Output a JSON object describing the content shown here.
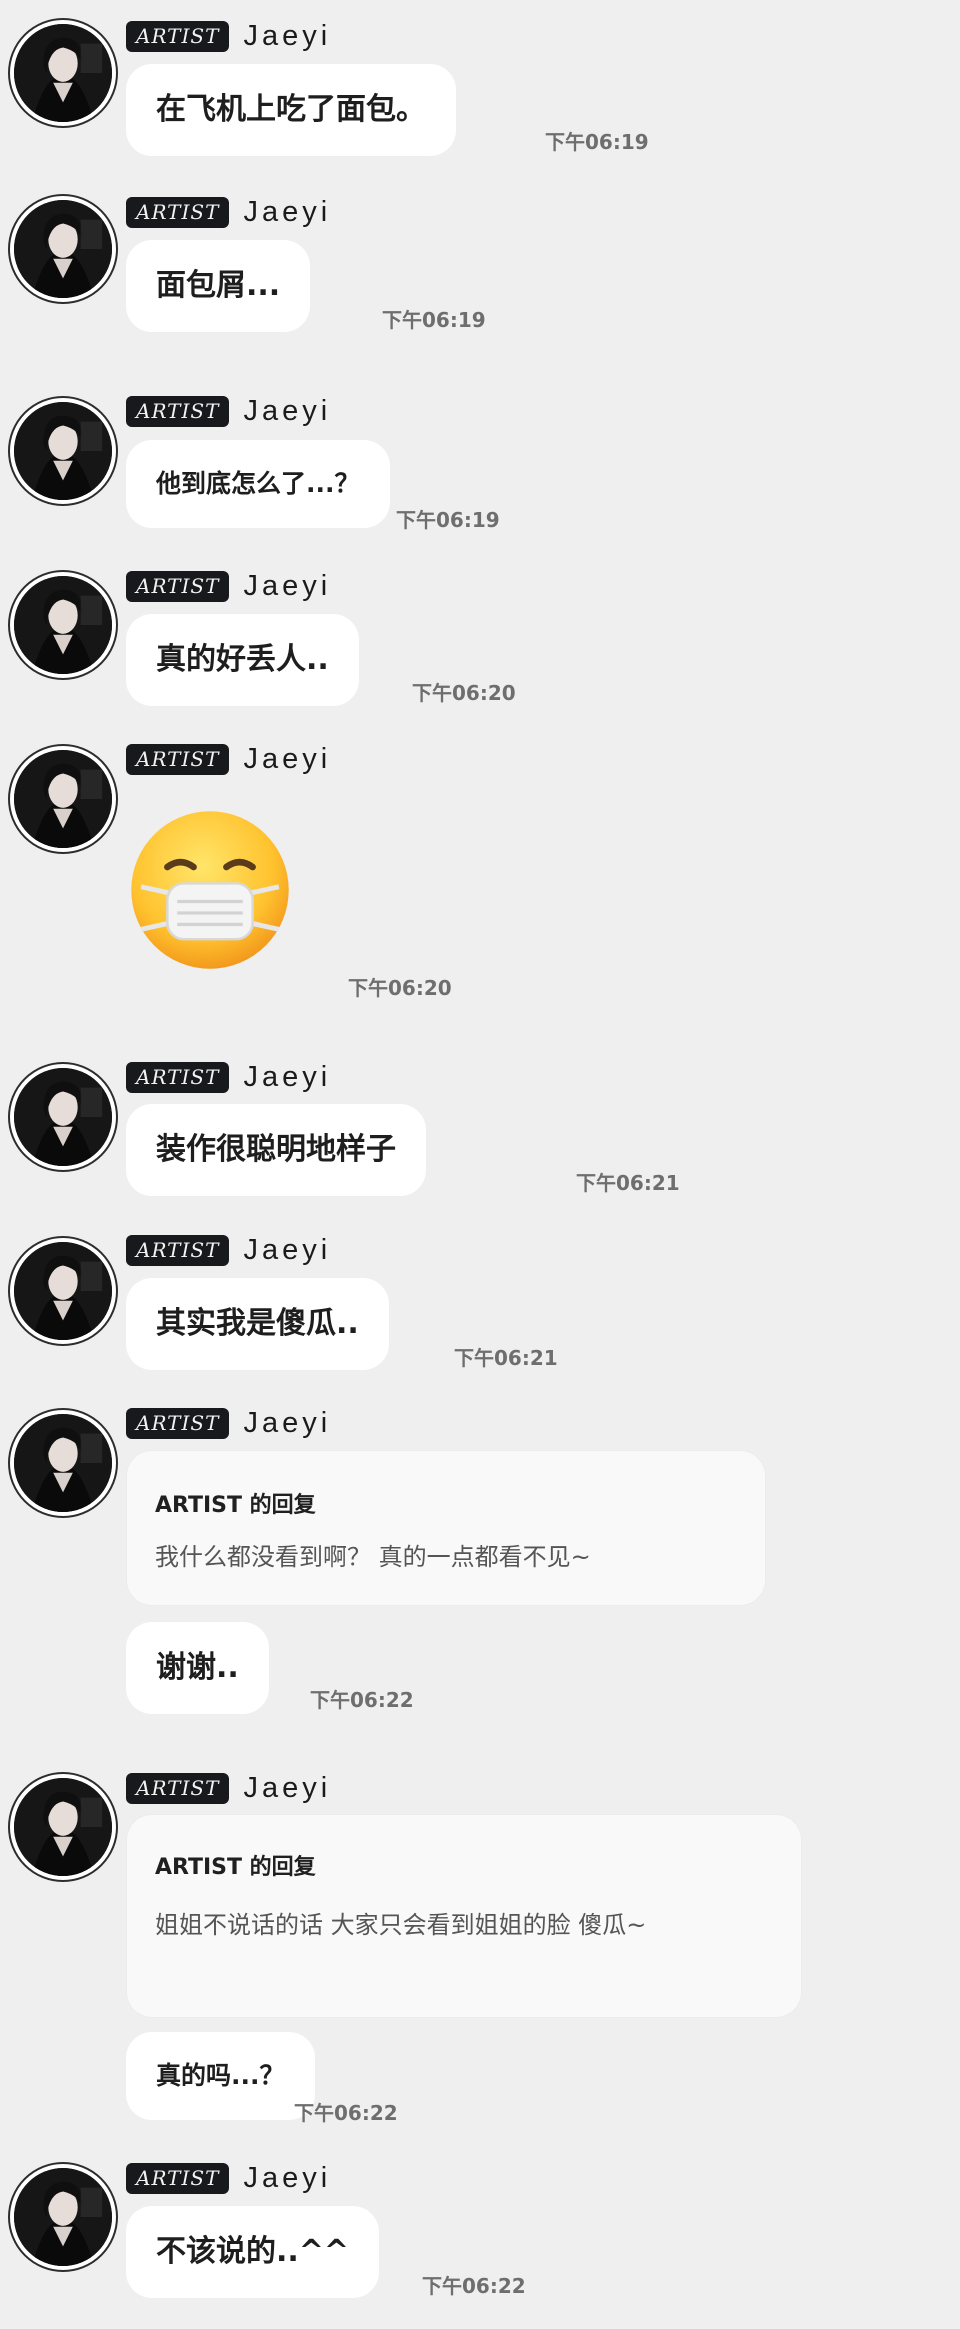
{
  "artist_badge": "ARTIST",
  "sender_name": "Jaeyi",
  "messages": [
    {
      "type": "text",
      "text": "在飞机上吃了面包。",
      "time": "下午06:19"
    },
    {
      "type": "text",
      "text": "面包屑...",
      "time": "下午06:19"
    },
    {
      "type": "text",
      "text": "他到底怎么了...？",
      "time": "下午06:19"
    },
    {
      "type": "text",
      "text": "真的好丢人..",
      "time": "下午06:20"
    },
    {
      "type": "emoji",
      "emoji_name": "face-with-medical-mask-emoji",
      "time": "下午06:20"
    },
    {
      "type": "text",
      "text": "装作很聪明地样子",
      "time": "下午06:21"
    },
    {
      "type": "text",
      "text": "其实我是傻瓜..",
      "time": "下午06:21"
    },
    {
      "type": "reply",
      "reply_title": "ARTIST 的回复",
      "reply_text": "我什么都没看到啊？ 真的一点都看不见~",
      "text": "谢谢..",
      "time": "下午06:22"
    },
    {
      "type": "reply",
      "reply_title": "ARTIST 的回复",
      "reply_text": "姐姐不说话的话 大家只会看到姐姐的脸 傻瓜~",
      "text": "真的吗...？",
      "time": "下午06:22"
    },
    {
      "type": "text",
      "text": "不该说的..^^",
      "time": "下午06:22"
    }
  ],
  "colors": {
    "background": "#efeff0",
    "bubble": "#ffffff",
    "badge": "#17191c",
    "timestamp": "#6e6e6e"
  }
}
